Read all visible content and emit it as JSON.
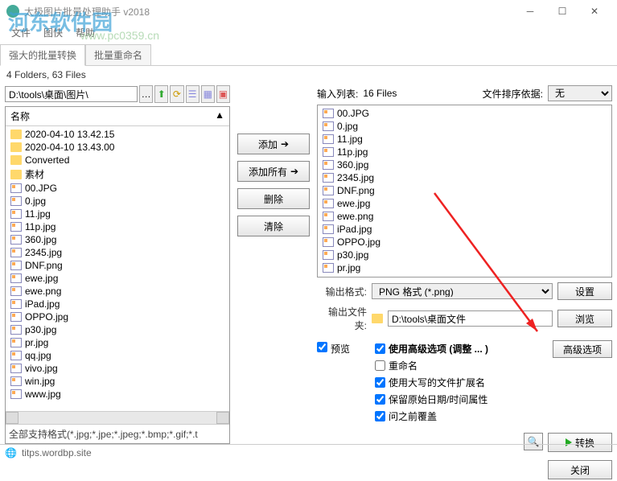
{
  "window": {
    "title": "太极图片批量处理助手   v2018",
    "menu": [
      "文件",
      "图快",
      "帮助"
    ]
  },
  "watermark": {
    "main": "河东软件园",
    "sub": "www.pc0359.cn"
  },
  "tabs": [
    "强大的批量转换",
    "批量重命名"
  ],
  "info_bar": "4 Folders, 63 Files",
  "address": "D:\\tools\\桌面\\图片\\",
  "left_list": {
    "header": "名称",
    "folders": [
      "2020-04-10 13.42.15",
      "2020-04-10 13.43.00",
      "Converted",
      "素材"
    ],
    "files": [
      "00.JPG",
      "0.jpg",
      "11.jpg",
      "11p.jpg",
      "360.jpg",
      "2345.jpg",
      "DNF.png",
      "ewe.jpg",
      "ewe.png",
      "iPad.jpg",
      "OPPO.jpg",
      "p30.jpg",
      "pr.jpg",
      "qq.jpg",
      "vivo.jpg",
      "win.jpg",
      "www.jpg"
    ],
    "footer": "全部支持格式(*.jpg;*.jpe;*.jpeg;*.bmp;*.gif;*.t"
  },
  "mid_buttons": {
    "add": "添加",
    "add_all": "添加所有",
    "del": "删除",
    "clear": "清除"
  },
  "right": {
    "input_label": "输入列表:",
    "file_count": "16 Files",
    "sort_label": "文件排序依据:",
    "sort_value": "无",
    "files": [
      "00.JPG",
      "0.jpg",
      "11.jpg",
      "11p.jpg",
      "360.jpg",
      "2345.jpg",
      "DNF.png",
      "ewe.jpg",
      "ewe.png",
      "iPad.jpg",
      "OPPO.jpg",
      "p30.jpg",
      "pr.jpg"
    ],
    "output_format_label": "输出格式:",
    "output_format_value": "PNG 格式 (*.png)",
    "settings_btn": "设置",
    "output_folder_label": "输出文件夹:",
    "output_folder_value": "D:\\tools\\桌面文件",
    "browse_btn": "浏览",
    "preview_label": "预览",
    "advanced_header": "使用高级选项 (调整 ... )",
    "advanced_btn": "高级选项",
    "opts": {
      "rename": "重命名",
      "uppercase_ext": "使用大写的文件扩展名",
      "keep_date": "保留原始日期/时间属性",
      "ask_overwrite": "问之前覆盖"
    },
    "convert_btn": "转换",
    "close_btn": "关闭"
  },
  "statusbar": {
    "url": "titps.wordbp.site"
  }
}
